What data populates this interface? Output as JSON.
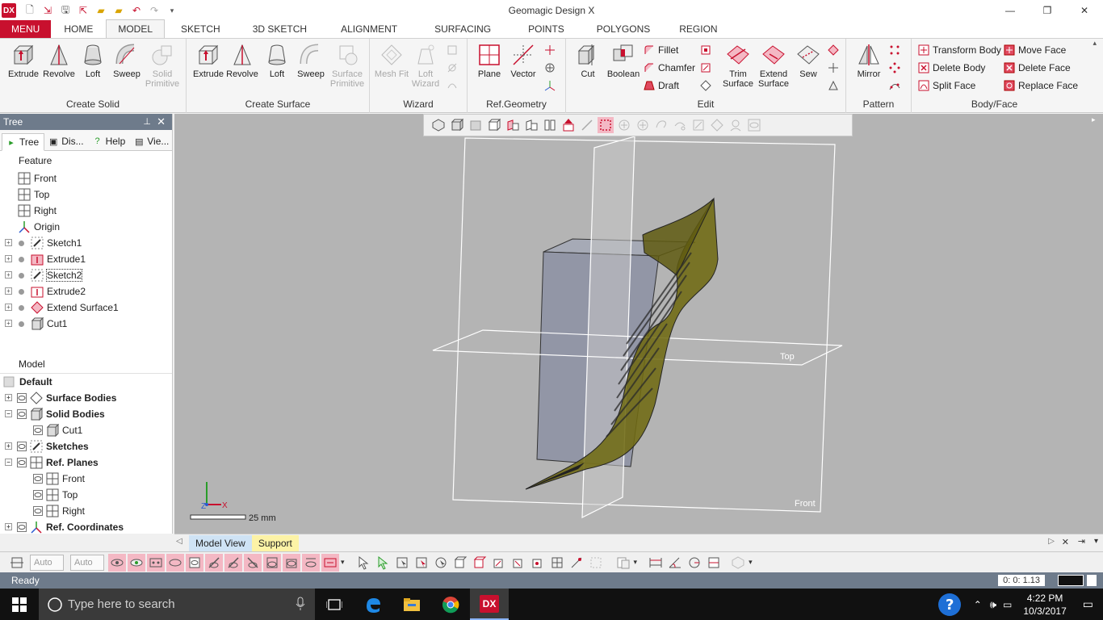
{
  "window": {
    "title": "Geomagic Design X",
    "logo": "DX"
  },
  "ribbon_tabs": [
    "MENU",
    "HOME",
    "MODEL",
    "SKETCH",
    "3D SKETCH",
    "ALIGNMENT",
    "SURFACING",
    "POINTS",
    "POLYGONS",
    "REGION"
  ],
  "active_tab": "MODEL",
  "groups": {
    "create_solid": {
      "label": "Create Solid",
      "buttons": [
        "Extrude",
        "Revolve",
        "Loft",
        "Sweep",
        "Solid Primitive"
      ]
    },
    "create_surface": {
      "label": "Create Surface",
      "buttons": [
        "Extrude",
        "Revolve",
        "Loft",
        "Sweep",
        "Surface Primitive"
      ]
    },
    "wizard": {
      "label": "Wizard",
      "buttons": [
        "Mesh Fit",
        "Loft Wizard"
      ]
    },
    "ref_geometry": {
      "label": "Ref.Geometry",
      "buttons": [
        "Plane",
        "Vector"
      ]
    },
    "edit": {
      "label": "Edit",
      "big": [
        "Cut",
        "Boolean",
        "Trim Surface",
        "Extend Surface",
        "Sew"
      ],
      "small": [
        "Fillet",
        "Chamfer",
        "Draft"
      ]
    },
    "pattern": {
      "label": "Pattern",
      "buttons": [
        "Mirror"
      ]
    },
    "body_face": {
      "label": "Body/Face",
      "items": [
        "Transform Body",
        "Delete Body",
        "Split Face",
        "Move Face",
        "Delete Face",
        "Replace Face"
      ]
    }
  },
  "tree_panel": {
    "title": "Tree",
    "tabs": [
      "Tree",
      "Dis...",
      "Help",
      "Vie..."
    ],
    "feature_label": "Feature",
    "features": [
      "Front",
      "Top",
      "Right",
      "Origin",
      "Sketch1",
      "Extrude1",
      "Sketch2",
      "Extrude2",
      "Extend Surface1",
      "Cut1"
    ],
    "model_label": "Model",
    "model_default": "Default",
    "model_items": [
      "Surface Bodies",
      "Solid Bodies",
      "Cut1",
      "Sketches",
      "Ref. Planes",
      "Front",
      "Top",
      "Right",
      "Ref. Coordinates"
    ]
  },
  "viewport": {
    "plane_top_label": "Top",
    "plane_front_label": "Front",
    "scale_label": "25 mm",
    "axis_x": "X",
    "axis_z": "Z",
    "tabs": [
      "Model View",
      "Support"
    ]
  },
  "bottom_toolbar": {
    "combo1": "Auto",
    "combo2": "Auto"
  },
  "status": {
    "text": "Ready",
    "timer": "0: 0: 1.13"
  },
  "taskbar": {
    "search_placeholder": "Type here to search",
    "time": "4:22 PM",
    "date": "10/3/2017",
    "dx_label": "DX"
  },
  "colors": {
    "accent": "#c8102e",
    "panel_header": "#6e7b8b",
    "viewport_bg": "#b4b4b4",
    "surface": "#6f6a12"
  }
}
